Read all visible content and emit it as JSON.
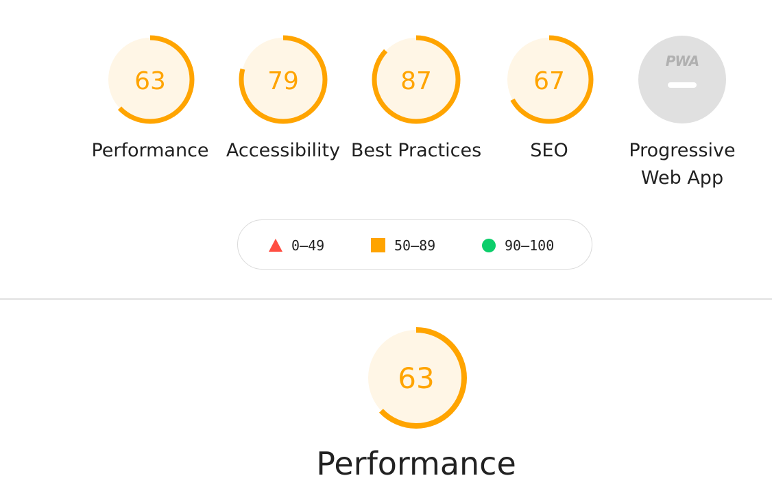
{
  "gauges": [
    {
      "score": "63",
      "label": "Performance",
      "fraction": 0.63,
      "color": "#ffa400"
    },
    {
      "score": "79",
      "label": "Accessibility",
      "fraction": 0.79,
      "color": "#ffa400"
    },
    {
      "score": "87",
      "label": "Best Practices",
      "fraction": 0.87,
      "color": "#ffa400"
    },
    {
      "score": "67",
      "label": "SEO",
      "fraction": 0.67,
      "color": "#ffa400"
    }
  ],
  "pwa": {
    "badge": "PWA",
    "label": "Progressive Web App",
    "icon": "pwa-icon"
  },
  "legend": {
    "fail": {
      "range": "0–49",
      "color": "#ff4e42",
      "icon": "triangle-icon"
    },
    "average": {
      "range": "50–89",
      "color": "#ffa400",
      "icon": "square-icon"
    },
    "pass": {
      "range": "90–100",
      "color": "#0cce6b",
      "icon": "circle-icon"
    }
  },
  "category": {
    "score": "63",
    "title": "Performance",
    "fraction": 0.63
  }
}
